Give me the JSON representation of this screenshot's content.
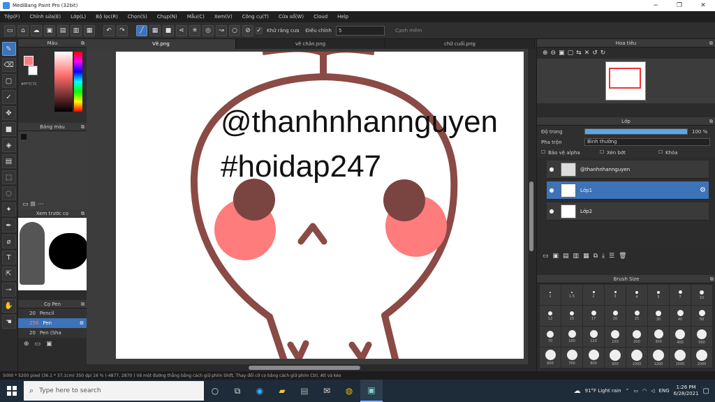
{
  "window": {
    "title": "MediBang Paint Pro (32bit)",
    "minimize": "−",
    "maximize": "❐",
    "close": "✕"
  },
  "menu": [
    "Tệp(F)",
    "Chỉnh sửa(E)",
    "Lớp(L)",
    "Bộ lọc(R)",
    "Chọn(S)",
    "Chụp(N)",
    "Mẫu(C)",
    "Xem(V)",
    "Công cụ(T)",
    "Cửa sổ(W)",
    "Cloud",
    "Help"
  ],
  "toolbar": {
    "auto_select_label": "Khử răng cưa",
    "correction_label": "Điều chỉnh",
    "correction_value": "5",
    "smooth_label": "Cạnh mềm"
  },
  "left_panels": {
    "color_title": "Màu",
    "palette_title": "Bảng màu",
    "preview_title": "Xem trước cọ",
    "brush_title": "Cọ Pen",
    "hex": "#FF7C7C"
  },
  "brushes": [
    {
      "size": "20",
      "name": "Pencil"
    },
    {
      "size": "256",
      "name": "Pen"
    },
    {
      "size": "20",
      "name": "Pen (Sha"
    }
  ],
  "tabs": [
    "Vẽ.png",
    "vẽ chân.png",
    "chữ cuối.png"
  ],
  "canvas_text": {
    "line1": "@thanhnhannguyen",
    "line2": "#hoidap247"
  },
  "right_panels": {
    "navigator_title": "Hoa tiêu",
    "layer_title": "Lớp",
    "opacity_label": "Độ trong",
    "opacity_value": "100 %",
    "opacity_fraction": 1.0,
    "blend_label": "Pha trộn",
    "blend_value": "Bình thường",
    "protect_alpha": "Bảo vệ alpha",
    "clipping": "Xén bớt",
    "lock": "Khóa",
    "brush_size_title": "Brush Size"
  },
  "layers": [
    {
      "name": "@thanhnhannguyen",
      "selected": false
    },
    {
      "name": "Lớp1",
      "selected": true
    },
    {
      "name": "Lớp2",
      "selected": false
    }
  ],
  "brush_sizes": [
    "1",
    "1.5",
    "2",
    "3",
    "4",
    "5",
    "7",
    "10",
    "12",
    "15",
    "17",
    "20",
    "25",
    "30",
    "40",
    "50",
    "70",
    "100",
    "120",
    "150",
    "200",
    "300",
    "400",
    "500",
    "600",
    "700",
    "800",
    "900",
    "1000",
    "1200",
    "1500",
    "2000"
  ],
  "status": "5000 * 5200 pixel  (36.1 * 37.1cm)  350 dpi  16 %  (-4877, 2870 )  Vẽ một đường thẳng bằng cách giữ phím Shift, Thay đổi cỡ cọ bằng cách giữ phím Ctrl, Alt và kéo",
  "taskbar": {
    "search_placeholder": "Type here to search",
    "weather": "91°F  Light rain",
    "lang": "ENG",
    "time": "1:26 PM",
    "date": "6/28/2021"
  },
  "colors": {
    "accent": "#3d73b8",
    "blush": "#ff7c7c",
    "outline": "#8b4a45",
    "eye": "#7a4440"
  }
}
